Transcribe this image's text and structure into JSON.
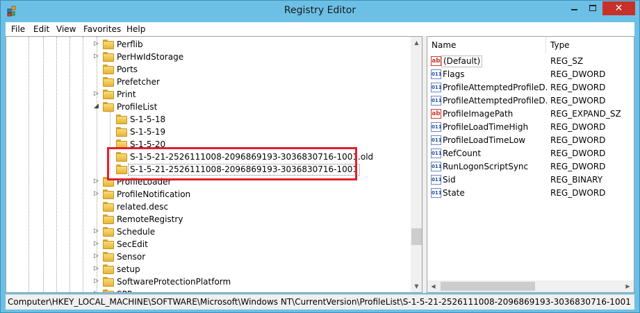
{
  "window": {
    "title": "Registry Editor",
    "close_glyph": "✕",
    "accent_color": "#6cc0e6"
  },
  "menu": [
    "File",
    "Edit",
    "View",
    "Favorites",
    "Help"
  ],
  "tree": {
    "items": [
      {
        "label": "Perflib",
        "expander": "▷"
      },
      {
        "label": "PerHwIdStorage",
        "expander": "▷"
      },
      {
        "label": "Ports",
        "expander": ""
      },
      {
        "label": "Prefetcher",
        "expander": ""
      },
      {
        "label": "Print",
        "expander": "▷"
      },
      {
        "label": "ProfileList",
        "expander": "◢"
      },
      {
        "label": "S-1-5-18",
        "expander": ""
      },
      {
        "label": "S-1-5-19",
        "expander": ""
      },
      {
        "label": "S-1-5-20",
        "expander": ""
      },
      {
        "label": "S-1-5-21-2526111008-2096869193-3036830716-1001.old",
        "expander": ""
      },
      {
        "label": "S-1-5-21-2526111008-2096869193-3036830716-1001",
        "expander": "",
        "selected": true
      },
      {
        "label": "ProfileLoader",
        "expander": "▷"
      },
      {
        "label": "ProfileNotification",
        "expander": "▷"
      },
      {
        "label": "related.desc",
        "expander": ""
      },
      {
        "label": "RemoteRegistry",
        "expander": ""
      },
      {
        "label": "Schedule",
        "expander": "▷"
      },
      {
        "label": "SecEdit",
        "expander": "▷"
      },
      {
        "label": "Sensor",
        "expander": "▷"
      },
      {
        "label": "setup",
        "expander": "▷"
      },
      {
        "label": "SoftwareProtectionPlatform",
        "expander": "▷"
      },
      {
        "label": "SPP",
        "expander": "▷"
      }
    ]
  },
  "list": {
    "columns": [
      "Name",
      "Type"
    ],
    "rows": [
      {
        "name": "(Default)",
        "type": "REG_SZ",
        "icon": "string-value-icon",
        "selected": true
      },
      {
        "name": "Flags",
        "type": "REG_DWORD",
        "icon": "binary-value-icon"
      },
      {
        "name": "ProfileAttemptedProfileD...",
        "type": "REG_DWORD",
        "icon": "binary-value-icon"
      },
      {
        "name": "ProfileAttemptedProfileD...",
        "type": "REG_DWORD",
        "icon": "binary-value-icon"
      },
      {
        "name": "ProfileImagePath",
        "type": "REG_EXPAND_SZ",
        "icon": "string-value-icon"
      },
      {
        "name": "ProfileLoadTimeHigh",
        "type": "REG_DWORD",
        "icon": "binary-value-icon"
      },
      {
        "name": "ProfileLoadTimeLow",
        "type": "REG_DWORD",
        "icon": "binary-value-icon"
      },
      {
        "name": "RefCount",
        "type": "REG_DWORD",
        "icon": "binary-value-icon"
      },
      {
        "name": "RunLogonScriptSync",
        "type": "REG_DWORD",
        "icon": "binary-value-icon"
      },
      {
        "name": "Sid",
        "type": "REG_BINARY",
        "icon": "binary-value-icon"
      },
      {
        "name": "State",
        "type": "REG_DWORD",
        "icon": "binary-value-icon"
      }
    ]
  },
  "icon_glyphs": {
    "string": "ab",
    "binary": "011"
  },
  "status": {
    "path": "Computer\\HKEY_LOCAL_MACHINE\\SOFTWARE\\Microsoft\\Windows NT\\CurrentVersion\\ProfileList\\S-1-5-21-2526111008-2096869193-3036830716-1001"
  },
  "highlight_color": "#e0202a"
}
